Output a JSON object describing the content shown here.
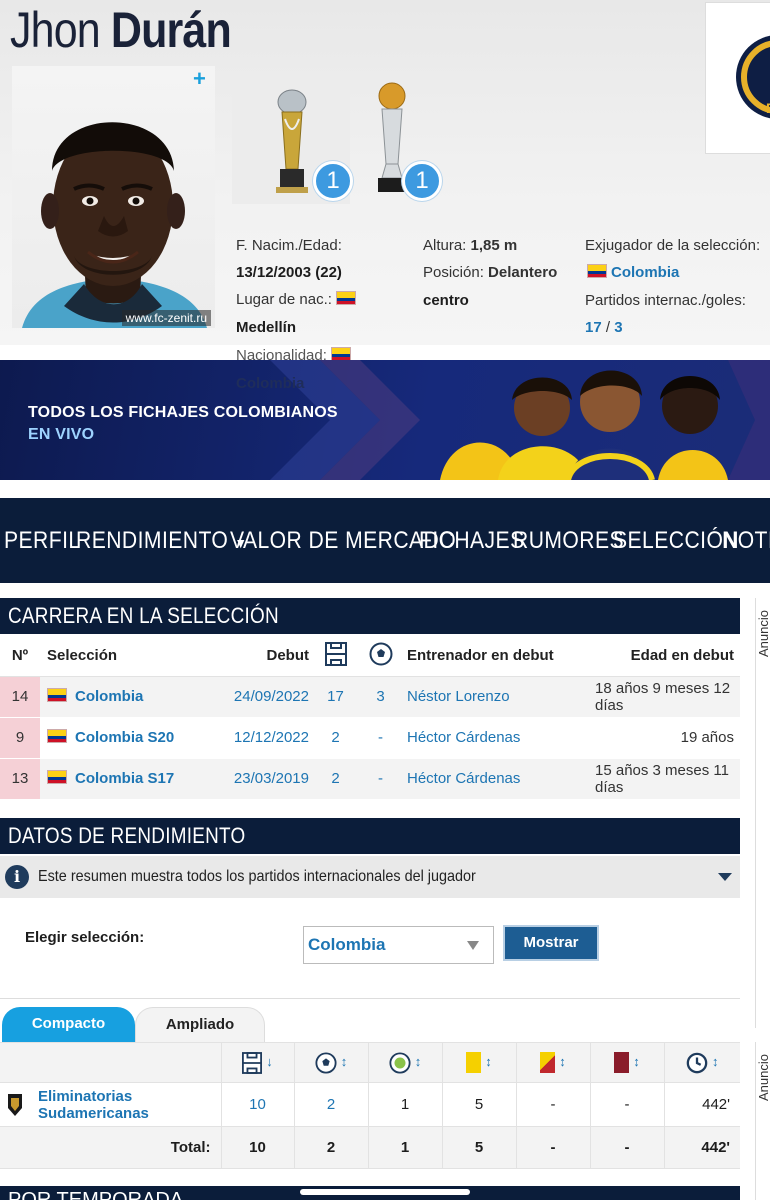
{
  "player": {
    "first_name": "Jhon",
    "last_name": "Durán",
    "photo_credit": "www.fc-zenit.ru"
  },
  "trophies": [
    {
      "name": "trophy-1",
      "count": "1"
    },
    {
      "name": "trophy-2",
      "count": "1"
    }
  ],
  "facts": {
    "birth_label": "F. Nacim./Edad:",
    "birth_value": "13/12/2003 (22)",
    "birthplace_label": "Lugar de nac.:",
    "birthplace_value": "Medellín",
    "nationality_label": "Nacionalidad:",
    "nationality_value": "Colombia",
    "height_label": "Altura:",
    "height_value": "1,85 m",
    "position_label": "Posición:",
    "position_value_1": "Delantero",
    "position_value_2": "centro",
    "former_intl_label": "Exjugador de la selección:",
    "former_intl_value": "Colombia",
    "caps_label": "Partidos internac./goles:",
    "caps_value": "17",
    "caps_sep": "/",
    "goals_value": "3"
  },
  "banner": {
    "line1": "TODOS LOS FICHAJES COLOMBIANOS",
    "line2": "EN VIVO"
  },
  "nav": [
    "PERFIL",
    "RENDIMIENTO",
    "VALOR DE MERCADO",
    "FICHAJES",
    "RUMORES",
    "SELECCIÓN",
    "NOTICIAS"
  ],
  "career": {
    "title": "CARRERA EN LA SELECCIÓN",
    "headers": {
      "no": "Nº",
      "team": "Selección",
      "debut": "Debut",
      "coach": "Entrenador en debut",
      "age": "Edad en debut"
    },
    "rows": [
      {
        "no": "14",
        "team": "Colombia",
        "debut": "24/09/2022",
        "apps": "17",
        "goals": "3",
        "coach": "Néstor Lorenzo",
        "age": "18 años 9 meses 12 días"
      },
      {
        "no": "9",
        "team": "Colombia S20",
        "debut": "12/12/2022",
        "apps": "2",
        "goals": "-",
        "coach": "Héctor Cárdenas",
        "age": "19 años"
      },
      {
        "no": "13",
        "team": "Colombia S17",
        "debut": "23/03/2019",
        "apps": "2",
        "goals": "-",
        "coach": "Héctor Cárdenas",
        "age": "15 años 3 meses 11 días"
      }
    ]
  },
  "performance": {
    "title": "DATOS DE RENDIMIENTO",
    "info": "Este resumen muestra todos los partidos internacionales del jugador",
    "choose_label": "Elegir selección:",
    "selected_team": "Colombia",
    "show_button": "Mostrar",
    "tabs": [
      "Compacto",
      "Ampliado"
    ],
    "rows": [
      {
        "competition": "Eliminatorias Sudamericanas",
        "apps": "10",
        "goals": "2",
        "assists": "1",
        "yellow": "5",
        "second_yellow": "-",
        "red": "-",
        "minutes": "442'"
      }
    ],
    "total": {
      "label": "Total:",
      "apps": "10",
      "goals": "2",
      "assists": "1",
      "yellow": "5",
      "second_yellow": "-",
      "red": "-",
      "minutes": "442'"
    }
  },
  "ad_label": "Anuncio",
  "next_section": "POR TEMPORADA",
  "colors": {
    "navy": "#0b1d3a",
    "link": "#1d75b3",
    "badge": "#3d9ae0",
    "number_bg": "#f5d0d6"
  }
}
